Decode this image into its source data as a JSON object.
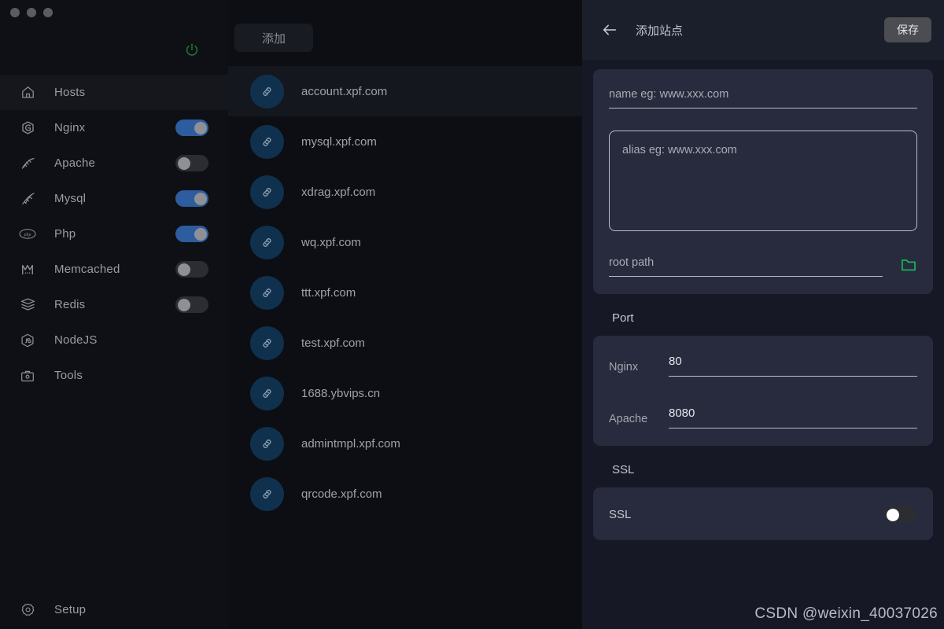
{
  "window": {
    "traffic_lights": [
      "close",
      "minimize",
      "maximize"
    ]
  },
  "sidebar": {
    "power_icon": "power-icon",
    "items": [
      {
        "label": "Hosts",
        "icon": "home-icon",
        "active": true,
        "toggle": null
      },
      {
        "label": "Nginx",
        "icon": "nginx-icon",
        "active": false,
        "toggle": "on"
      },
      {
        "label": "Apache",
        "icon": "apache-icon",
        "active": false,
        "toggle": "off"
      },
      {
        "label": "Mysql",
        "icon": "mysql-icon",
        "active": false,
        "toggle": "on"
      },
      {
        "label": "Php",
        "icon": "php-icon",
        "active": false,
        "toggle": "on"
      },
      {
        "label": "Memcached",
        "icon": "memcached-icon",
        "active": false,
        "toggle": "off"
      },
      {
        "label": "Redis",
        "icon": "redis-icon",
        "active": false,
        "toggle": "off"
      },
      {
        "label": "NodeJS",
        "icon": "nodejs-icon",
        "active": false,
        "toggle": null
      },
      {
        "label": "Tools",
        "icon": "tools-icon",
        "active": false,
        "toggle": null
      }
    ],
    "setup": {
      "label": "Setup",
      "icon": "gear-icon"
    }
  },
  "hostlist": {
    "add_label": "添加",
    "item_icon": "link-icon",
    "items": [
      {
        "name": "account.xpf.com",
        "selected": true
      },
      {
        "name": "mysql.xpf.com",
        "selected": false
      },
      {
        "name": "xdrag.xpf.com",
        "selected": false
      },
      {
        "name": "wq.xpf.com",
        "selected": false
      },
      {
        "name": "ttt.xpf.com",
        "selected": false
      },
      {
        "name": "test.xpf.com",
        "selected": false
      },
      {
        "name": "1688.ybvips.cn",
        "selected": false
      },
      {
        "name": "admintmpl.xpf.com",
        "selected": false
      },
      {
        "name": "qrcode.xpf.com",
        "selected": false
      }
    ]
  },
  "detail": {
    "back_icon": "arrow-left-icon",
    "title": "添加站点",
    "save_label": "保存",
    "basic": {
      "name_placeholder": "name eg: www.xxx.com",
      "alias_placeholder": "alias eg: www.xxx.com",
      "rootpath_placeholder": "root path",
      "folder_icon": "folder-icon"
    },
    "port": {
      "section_title": "Port",
      "rows": [
        {
          "label": "Nginx",
          "value": "80"
        },
        {
          "label": "Apache",
          "value": "8080"
        }
      ]
    },
    "ssl": {
      "section_title": "SSL",
      "row_label": "SSL",
      "toggle": "off"
    }
  },
  "watermark": {
    "text": "CSDN @weixin_40037026"
  },
  "colors": {
    "accent_blue": "#2d5d9f",
    "accent_green": "#14b65a",
    "card_bg": "#282b3d",
    "panel_bg": "#161925",
    "sidebar_bg": "#0e1015"
  }
}
